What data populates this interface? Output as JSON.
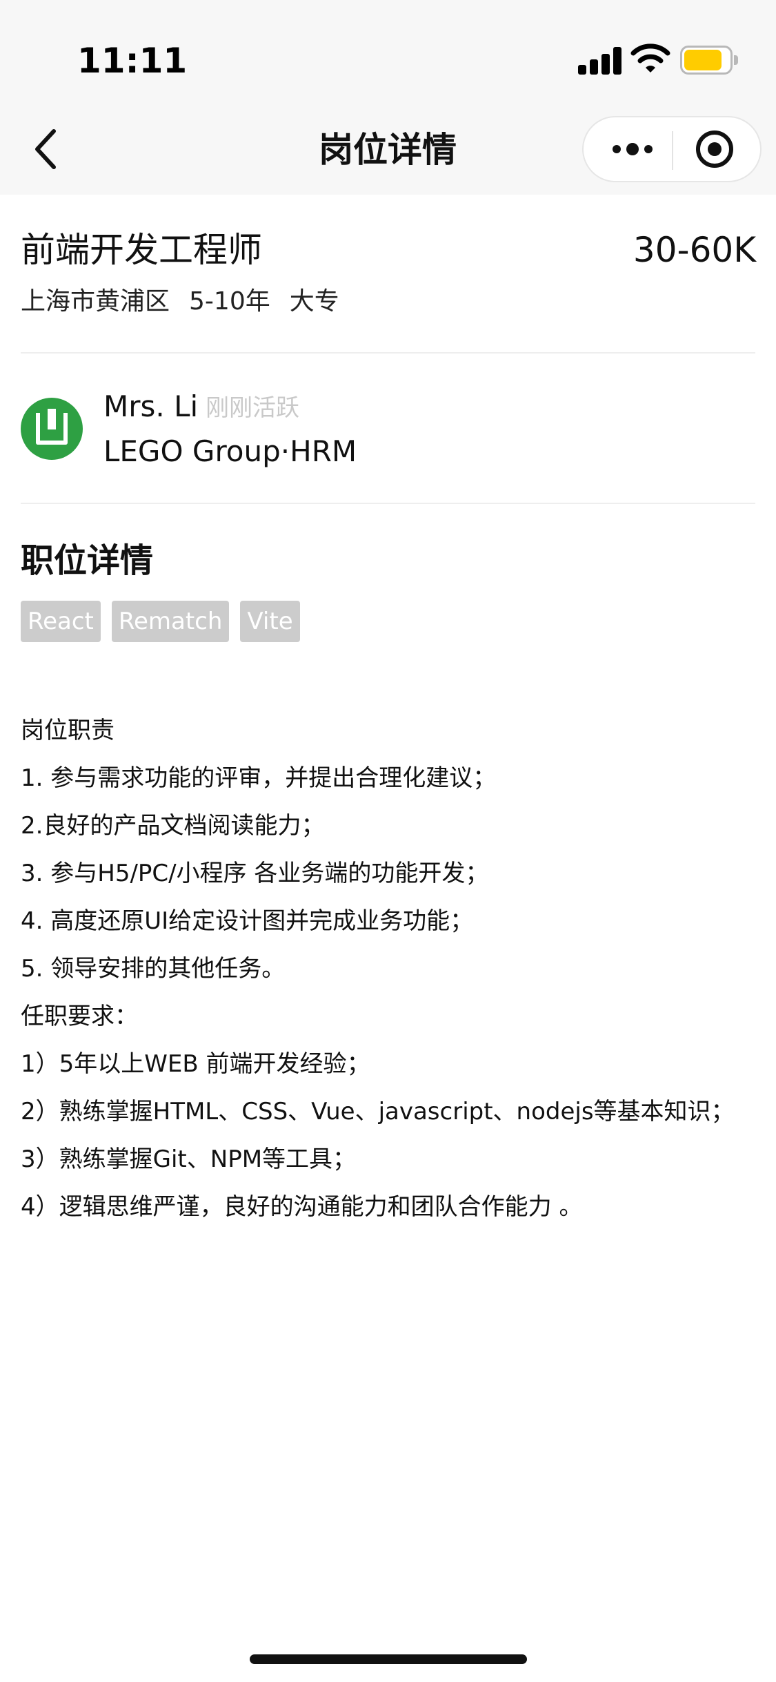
{
  "status_bar": {
    "time": "11:11",
    "battery_level": 0.85,
    "battery_color": "#ffcc00"
  },
  "nav": {
    "title": "岗位详情",
    "back_icon": "chevron-left-icon",
    "more_icon": "more-dots-icon",
    "close_icon": "target-circle-icon"
  },
  "job": {
    "title": "前端开发工程师",
    "salary": "30-60K",
    "location": "上海市黄浦区",
    "experience": "5-10年",
    "education": "大专"
  },
  "recruiter": {
    "name": "Mrs. Li",
    "status": "刚刚活跃",
    "company": "LEGO Group·HRM",
    "avatar_color": "#2ea043"
  },
  "details": {
    "section_title": "职位详情",
    "tags": [
      "React",
      "Rematch",
      "Vite"
    ],
    "lines": [
      "岗位职责",
      "1. 参与需求功能的评审，并提出合理化建议；",
      "2.良好的产品文档阅读能力；",
      "3. 参与H5/PC/小程序 各业务端的功能开发；",
      "4. 高度还原UI给定设计图并完成业务功能；",
      "5. 领导安排的其他任务。",
      "任职要求：",
      "1）5年以上WEB 前端开发经验；",
      "2）熟练掌握HTML、CSS、Vue、javascript、nodejs等基本知识；",
      "3）熟练掌握Git、NPM等工具；",
      "4）逻辑思维严谨，良好的沟通能力和团队合作能力 。"
    ]
  }
}
